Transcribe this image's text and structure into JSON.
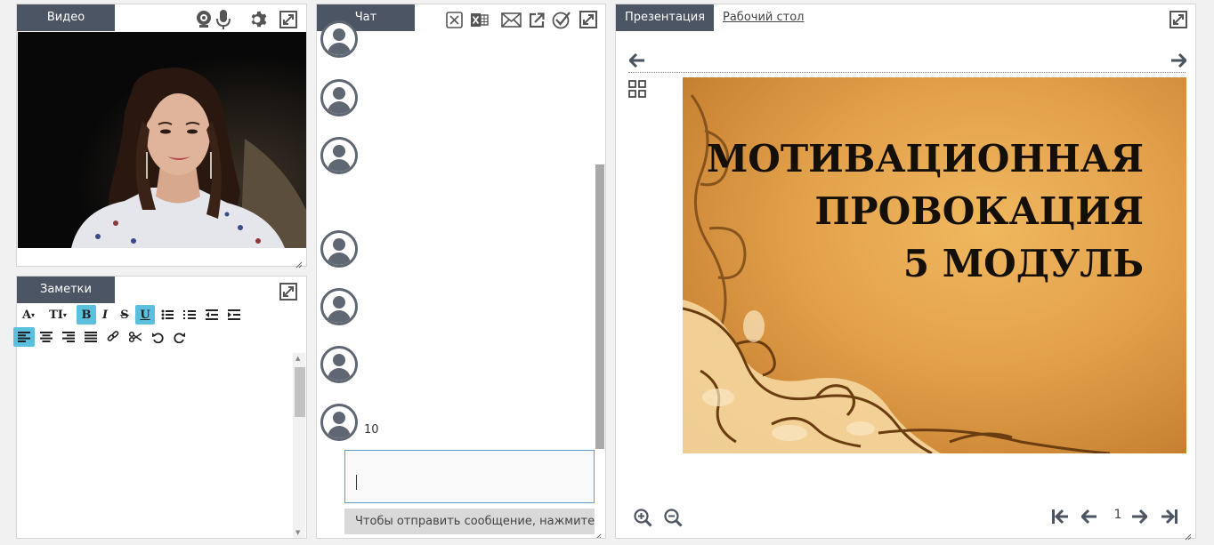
{
  "video": {
    "tab_label": "Видео"
  },
  "notes": {
    "tab_label": "Заметки"
  },
  "chat": {
    "tab_label": "Чат",
    "last_message_text": "10",
    "input_value": "",
    "send_hint": "Чтобы отправить сообщение, нажмите Ent"
  },
  "presentation": {
    "tab_label": "Презентация",
    "desktop_tab_label": "Рабочий стол",
    "slide_title_lines": [
      "МОТИВАЦИОННАЯ",
      "ПРОВОКАЦИЯ",
      "5 МОДУЛЬ"
    ],
    "page_number": "1"
  },
  "colors": {
    "tab_background": "#4b5563",
    "toolbar_active": "#5bc0de",
    "input_border": "#5b9bd5"
  }
}
